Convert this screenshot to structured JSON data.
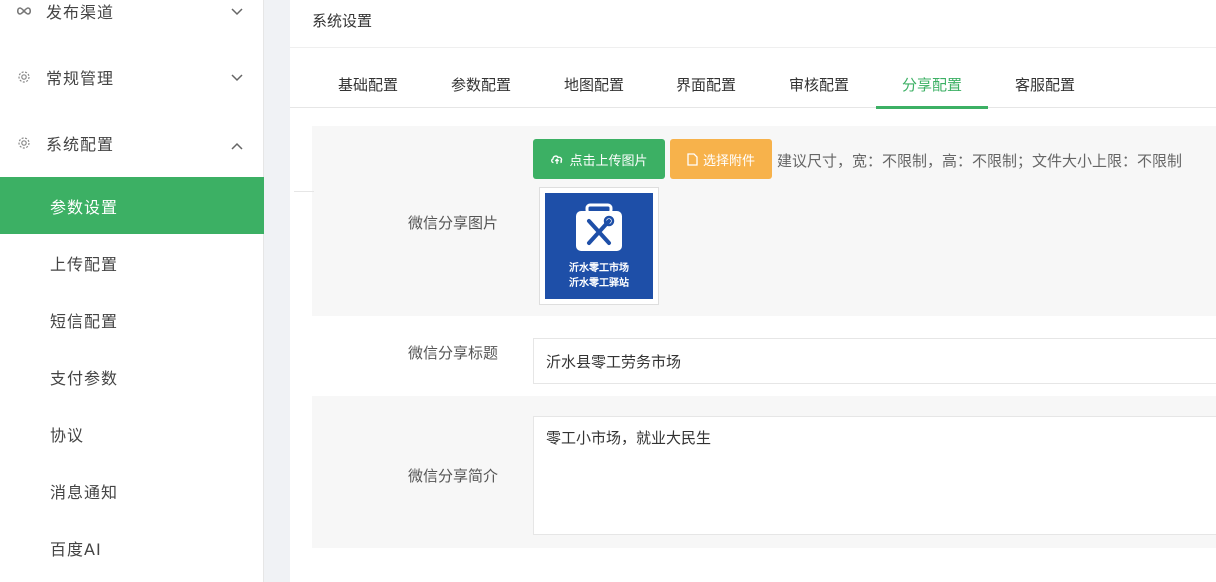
{
  "sidebar": {
    "groups": [
      {
        "label": "发布渠道",
        "icon": "infinity-icon",
        "expanded": false
      },
      {
        "label": "常规管理",
        "icon": "gear-icon",
        "expanded": false
      },
      {
        "label": "系统配置",
        "icon": "gear-icon",
        "expanded": true
      }
    ],
    "items": [
      {
        "label": "参数设置",
        "active": true
      },
      {
        "label": "上传配置",
        "active": false
      },
      {
        "label": "短信配置",
        "active": false
      },
      {
        "label": "支付参数",
        "active": false
      },
      {
        "label": "协议",
        "active": false
      },
      {
        "label": "消息通知",
        "active": false
      },
      {
        "label": "百度AI",
        "active": false
      }
    ]
  },
  "main": {
    "title": "系统设置",
    "tabs": [
      {
        "label": "基础配置",
        "active": false
      },
      {
        "label": "参数配置",
        "active": false
      },
      {
        "label": "地图配置",
        "active": false
      },
      {
        "label": "界面配置",
        "active": false
      },
      {
        "label": "审核配置",
        "active": false
      },
      {
        "label": "分享配置",
        "active": true
      },
      {
        "label": "客服配置",
        "active": false
      }
    ],
    "form": {
      "share_image": {
        "label": "微信分享图片",
        "upload_button": "点击上传图片",
        "attach_button": "选择附件",
        "hint": "建议尺寸，宽：不限制，高：不限制；文件大小上限：不限制",
        "image_text_line1": "沂水零工市场",
        "image_text_line2": "沂水零工驿站"
      },
      "share_title": {
        "label": "微信分享标题",
        "value": "沂水县零工劳务市场"
      },
      "share_desc": {
        "label": "微信分享简介",
        "value": "零工小市场，就业大民生"
      }
    }
  },
  "colors": {
    "accent": "#3cb064",
    "orange": "#f7b24b",
    "logo_bg": "#1e4fa8"
  }
}
